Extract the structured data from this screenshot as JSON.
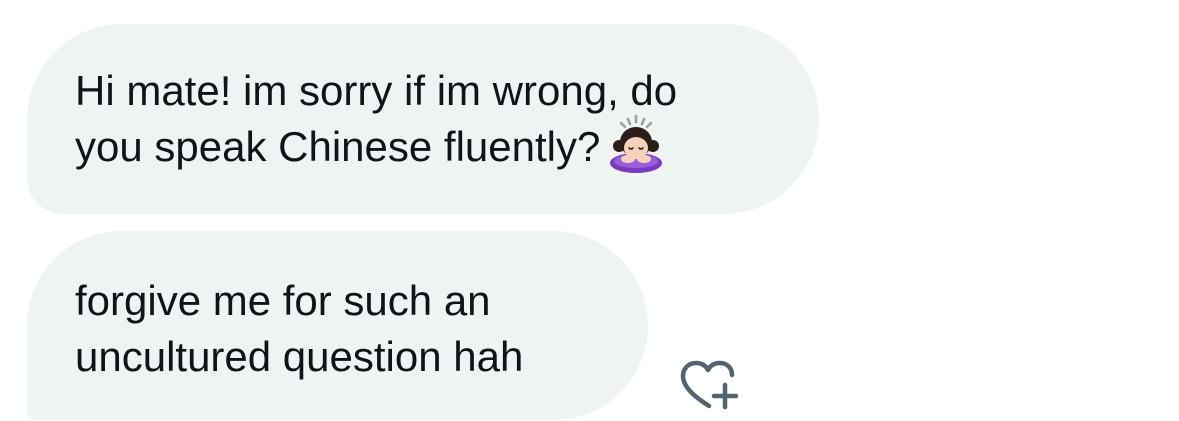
{
  "messages": [
    {
      "lines": [
        "Hi mate! im sorry if im wrong, do",
        "you speak Chinese fluently?"
      ],
      "emoji": "person-bowing-icon"
    },
    {
      "lines": [
        "forgive me for such an",
        "uncultured question hah"
      ]
    }
  ],
  "reaction_button": {
    "icon": "heart-plus-icon"
  },
  "colors": {
    "bubble_bg": "#eff3f4",
    "text": "#0f1419",
    "icon": "#536471"
  }
}
